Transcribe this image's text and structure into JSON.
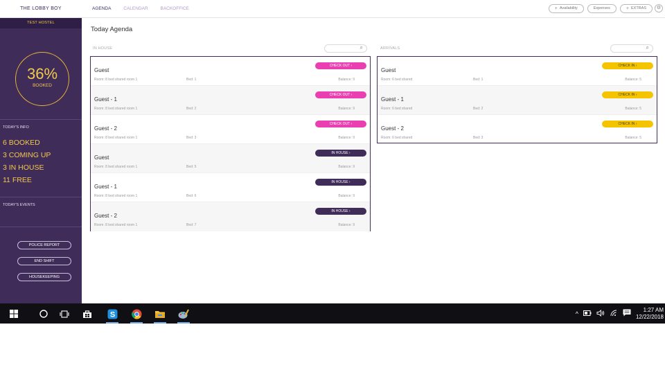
{
  "app": {
    "logo": "THE LOBBY BOY",
    "nav": [
      {
        "label": "AGENDA",
        "active": true
      },
      {
        "label": "CALENDAR",
        "active": false
      },
      {
        "label": "BACKOFFICE",
        "active": false
      }
    ],
    "top_buttons": {
      "availability": "Availability",
      "expenses": "Expenses",
      "extras": "EXTRAS"
    }
  },
  "sidebar": {
    "hostel": "TEST HOSTEL",
    "booked_pct": "36%",
    "booked_label": "BOOKED",
    "todays_info_title": "TODAY'S INFO",
    "stats": [
      "6 BOOKED",
      "3 COMING UP",
      "3 IN HOUSE",
      "11 FREE"
    ],
    "todays_events_title": "TODAY'S EVENTS",
    "buttons": {
      "police_report": "POLICE REPORT",
      "end_shift": "END SHIFT",
      "housekeeping": "HOUSEKEEPING"
    }
  },
  "main": {
    "title": "Today Agenda",
    "in_house": {
      "heading": "IN HOUSE",
      "rows": [
        {
          "guest": "Guest",
          "room": "Room: 8 bed shared room 1",
          "bed": "Bed: 1",
          "balance": "Balance: 9",
          "action": "CHECK OUT"
        },
        {
          "guest": "Guest - 1",
          "room": "Room: 8 bed shared room 1",
          "bed": "Bed: 2",
          "balance": "Balance: 9",
          "action": "CHECK OUT"
        },
        {
          "guest": "Guest - 2",
          "room": "Room: 8 bed shared room 1",
          "bed": "Bed: 3",
          "balance": "Balance: 9",
          "action": "CHECK OUT"
        },
        {
          "guest": "Guest",
          "room": "Room: 8 bed shared room 1",
          "bed": "Bed: 5",
          "balance": "Balance: 9",
          "action": "IN HOUSE"
        },
        {
          "guest": "Guest - 1",
          "room": "Room: 8 bed shared room 1",
          "bed": "Bed: 6",
          "balance": "Balance: 9",
          "action": "IN HOUSE"
        },
        {
          "guest": "Guest - 2",
          "room": "Room: 8 bed shared room 1",
          "bed": "Bed: 7",
          "balance": "Balance: 9",
          "action": "IN HOUSE"
        }
      ]
    },
    "arrivals": {
      "heading": "ARRIVALS",
      "rows": [
        {
          "guest": "Guest",
          "room": "Room: 6 bed shared",
          "bed": "Bed: 1",
          "balance": "Balance: 5",
          "action": "CHECK IN"
        },
        {
          "guest": "Guest - 1",
          "room": "Room: 6 bed shared",
          "bed": "Bed: 2",
          "balance": "Balance: 5",
          "action": "CHECK IN"
        },
        {
          "guest": "Guest - 2",
          "room": "Room: 6 bed shared",
          "bed": "Bed: 3",
          "balance": "Balance: 5",
          "action": "CHECK IN"
        }
      ]
    }
  },
  "taskbar": {
    "time": "1:27 AM",
    "date": "12/22/2018"
  },
  "colors": {
    "sidebar": "#3f2c59",
    "accent_yellow": "#f2c94c",
    "checkout_pink": "#ea3fb0",
    "checkin_yellow": "#f5c400"
  }
}
